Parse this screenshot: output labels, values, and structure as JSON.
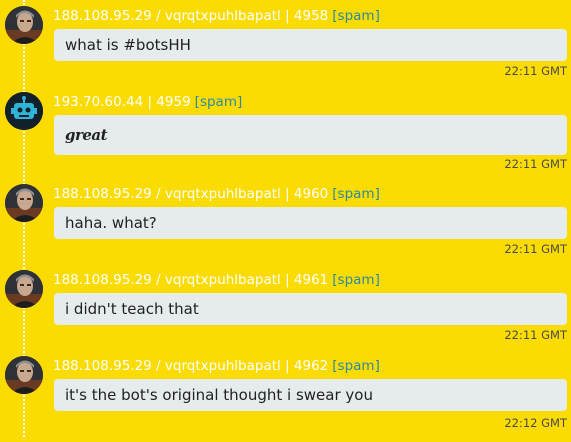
{
  "theme": {
    "background": "#fbdc02",
    "bubble": "#e6ecee",
    "spam_link": "#2b8aa0",
    "meta_text": "#ffffff"
  },
  "messages": [
    {
      "avatar": "user-photo-avatar",
      "meta": "188.108.95.29 / vqrqtxpuhlbapatl | 4958",
      "spam": "[spam]",
      "text": "what is #botsHH",
      "time": "22:11 GMT"
    },
    {
      "avatar": "bot-avatar",
      "meta": "193.70.60.44 | 4959",
      "spam": "[spam]",
      "text": "great",
      "time": "22:11 GMT"
    },
    {
      "avatar": "user-photo-avatar",
      "meta": "188.108.95.29 / vqrqtxpuhlbapatl | 4960",
      "spam": "[spam]",
      "text": "haha. what?",
      "time": "22:11 GMT"
    },
    {
      "avatar": "user-photo-avatar",
      "meta": "188.108.95.29 / vqrqtxpuhlbapatl | 4961",
      "spam": "[spam]",
      "text": "i didn't teach that",
      "time": "22:11 GMT"
    },
    {
      "avatar": "user-photo-avatar",
      "meta": "188.108.95.29 / vqrqtxpuhlbapatl | 4962",
      "spam": "[spam]",
      "text": "it's the bot's original thought i swear you",
      "time": "22:12 GMT"
    }
  ]
}
